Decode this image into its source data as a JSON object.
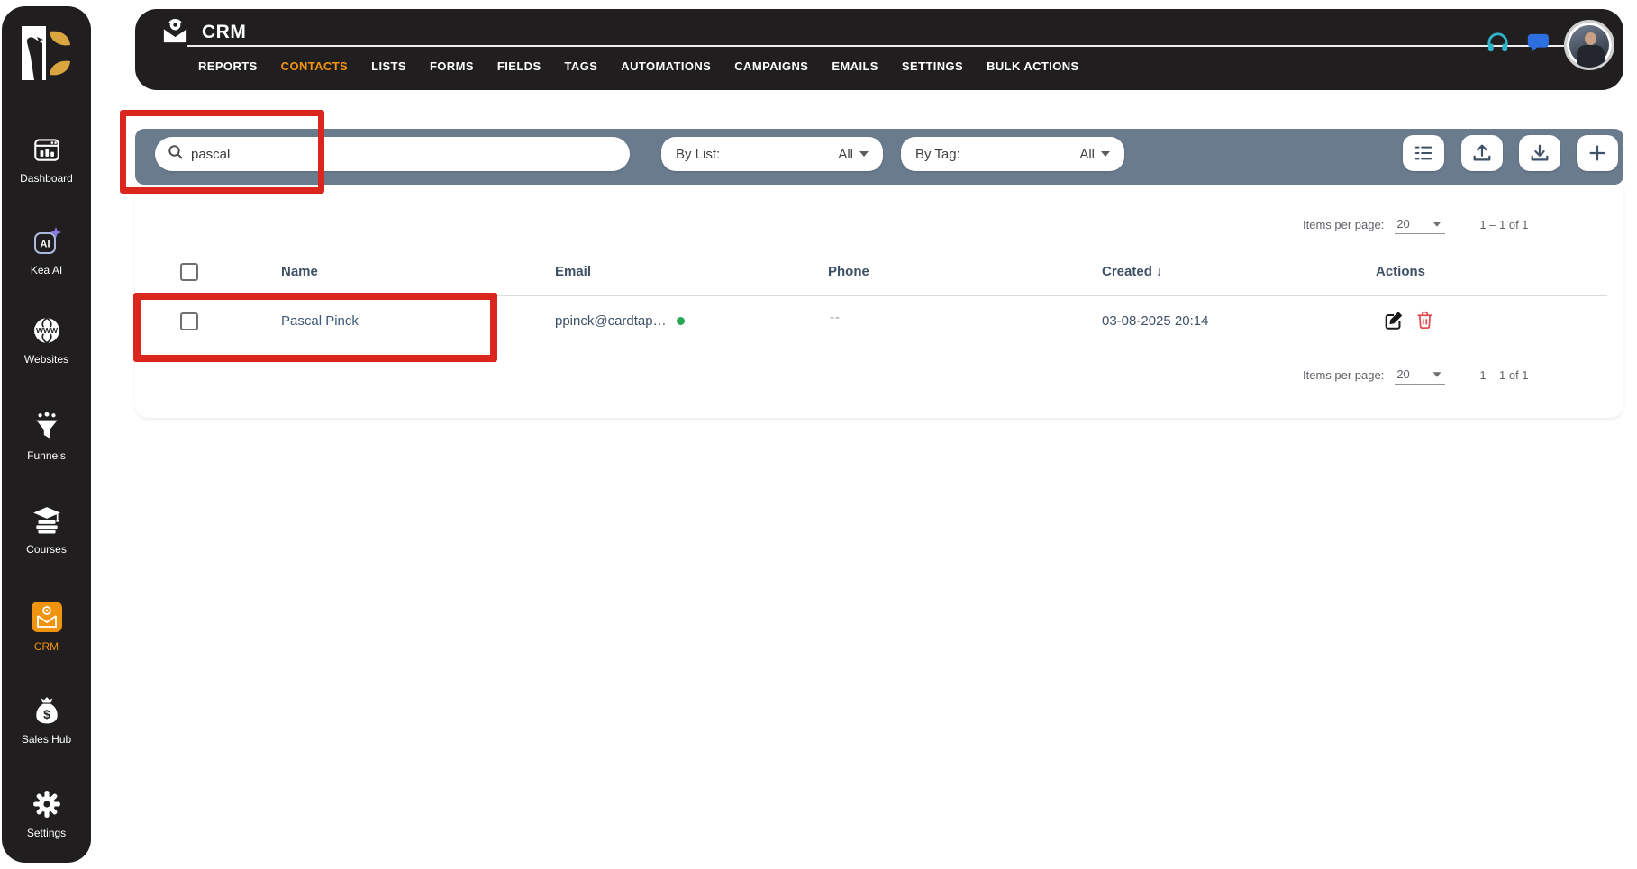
{
  "header": {
    "title": "CRM",
    "nav": [
      {
        "label": "REPORTS"
      },
      {
        "label": "CONTACTS",
        "active": true
      },
      {
        "label": "LISTS"
      },
      {
        "label": "FORMS"
      },
      {
        "label": "FIELDS"
      },
      {
        "label": "TAGS"
      },
      {
        "label": "AUTOMATIONS"
      },
      {
        "label": "CAMPAIGNS"
      },
      {
        "label": "EMAILS"
      },
      {
        "label": "SETTINGS"
      },
      {
        "label": "BULK ACTIONS"
      }
    ]
  },
  "sidebar": {
    "items": [
      {
        "label": "Dashboard",
        "icon": "dashboard-icon"
      },
      {
        "label": "Kea AI",
        "icon": "kea-ai-icon"
      },
      {
        "label": "Websites",
        "icon": "websites-icon"
      },
      {
        "label": "Funnels",
        "icon": "funnels-icon"
      },
      {
        "label": "Courses",
        "icon": "courses-icon"
      },
      {
        "label": "CRM",
        "icon": "crm-icon",
        "active": true
      },
      {
        "label": "Sales Hub",
        "icon": "sales-hub-icon"
      },
      {
        "label": "Settings",
        "icon": "settings-icon"
      }
    ]
  },
  "filters": {
    "search_value": "pascal",
    "by_list": {
      "label": "By List:",
      "value": "All"
    },
    "by_tag": {
      "label": "By Tag:",
      "value": "All"
    }
  },
  "toolbar": {
    "buttons": [
      "list-view-icon",
      "upload-icon",
      "download-icon",
      "add-icon"
    ]
  },
  "table": {
    "columns": {
      "name": "Name",
      "email": "Email",
      "phone": "Phone",
      "created": "Created",
      "actions": "Actions"
    },
    "sort_arrow": "↓",
    "rows": [
      {
        "name": "Pascal Pinck",
        "email": "ppinck@cardtap…",
        "email_status": "active",
        "phone": "--",
        "created": "03-08-2025 20:14"
      }
    ]
  },
  "pagination": {
    "label": "Items per page:",
    "per_page": "20",
    "range": "1 – 1 of 1"
  },
  "colors": {
    "accent_orange": "#f0930f",
    "dark_bg": "#201e1f",
    "filter_bar": "#6b7b8e",
    "annotation_red": "#db261d",
    "status_green": "#28a652",
    "delete_red": "#e04b50",
    "headphones_teal": "#2fb3c9",
    "chat_blue": "#2d6fe0"
  }
}
